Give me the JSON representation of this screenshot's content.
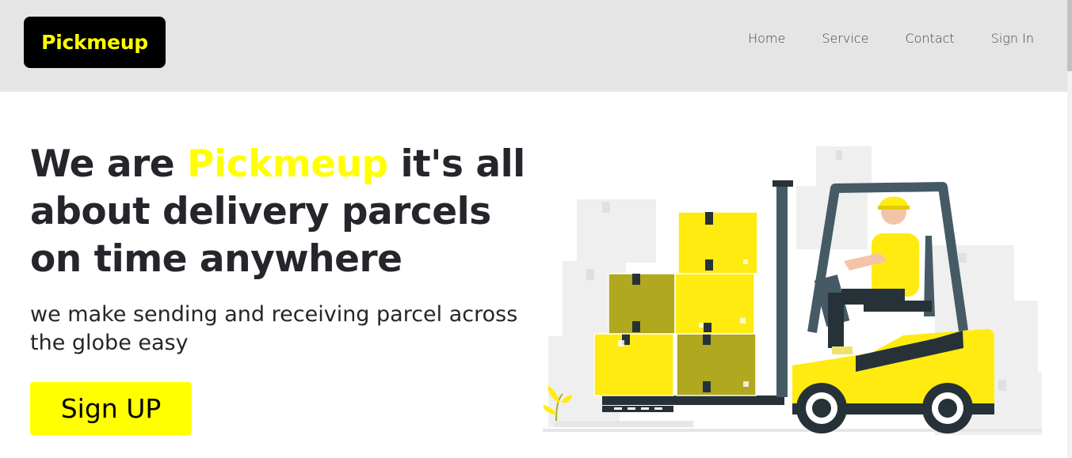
{
  "brand": {
    "name": "Pickmeup"
  },
  "nav": {
    "items": [
      {
        "label": "Home"
      },
      {
        "label": "Service"
      },
      {
        "label": "Contact"
      },
      {
        "label": "Sign In"
      }
    ]
  },
  "hero": {
    "title_prefix": "We are ",
    "title_accent": "Pickmeup",
    "title_suffix": " it's all about delivery parcels on time anywhere",
    "subtitle": "we make sending and receiving parcel across the globe easy",
    "cta_label": "Sign UP"
  },
  "illustration": {
    "icon": "forklift-delivery-illustration"
  },
  "colors": {
    "accent": "#ffff00",
    "nav_bg": "#e5e5e5",
    "text": "#25262b",
    "brand_bg": "#000000"
  }
}
